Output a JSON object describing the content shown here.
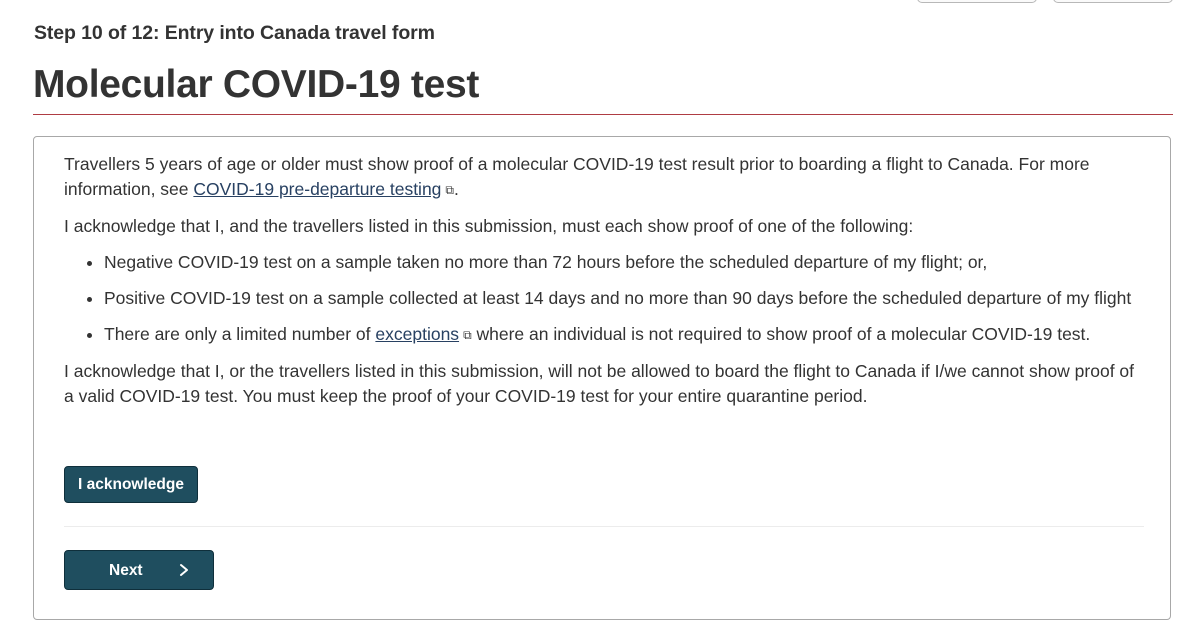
{
  "header": {
    "step": "Step 10 of 12: Entry into Canada travel form",
    "title": "Molecular COVID-19 test"
  },
  "panel": {
    "intro_text": "Travellers 5 years of age or older must show proof of a molecular COVID-19 test result prior to boarding a flight to Canada. For more information, see ",
    "intro_link": "COVID-19 pre-departure testing",
    "intro_end": ".",
    "acknowledge_intro": "I acknowledge that I, and the travellers listed in this submission, must each show proof of one of the following:",
    "items": [
      {
        "text": "Negative COVID-19 test on a sample taken no more than 72 hours before the scheduled departure of my flight; or,"
      },
      {
        "text": "Positive COVID-19 test on a sample collected at least 14 days and no more than 90 days before the scheduled departure of my flight"
      },
      {
        "before": "There are only a limited number of ",
        "link": "exceptions",
        "after": " where an individual is not required to show proof of a molecular COVID-19 test."
      }
    ],
    "closing_text": "I acknowledge that I, or the travellers listed in this submission, will not be allowed to board the flight to Canada if I/we cannot show proof of a valid COVID-19 test. You must keep the proof of your COVID-19 test for your entire quarantine period.",
    "acknowledge_button": "I acknowledge",
    "next_button": "Next"
  },
  "icons": {
    "external_link": "external-link-icon",
    "chevron": "chevron-right-icon"
  },
  "colors": {
    "button_bg": "#1f4e5f",
    "title_rule": "#af3c43",
    "link": "#284162"
  }
}
